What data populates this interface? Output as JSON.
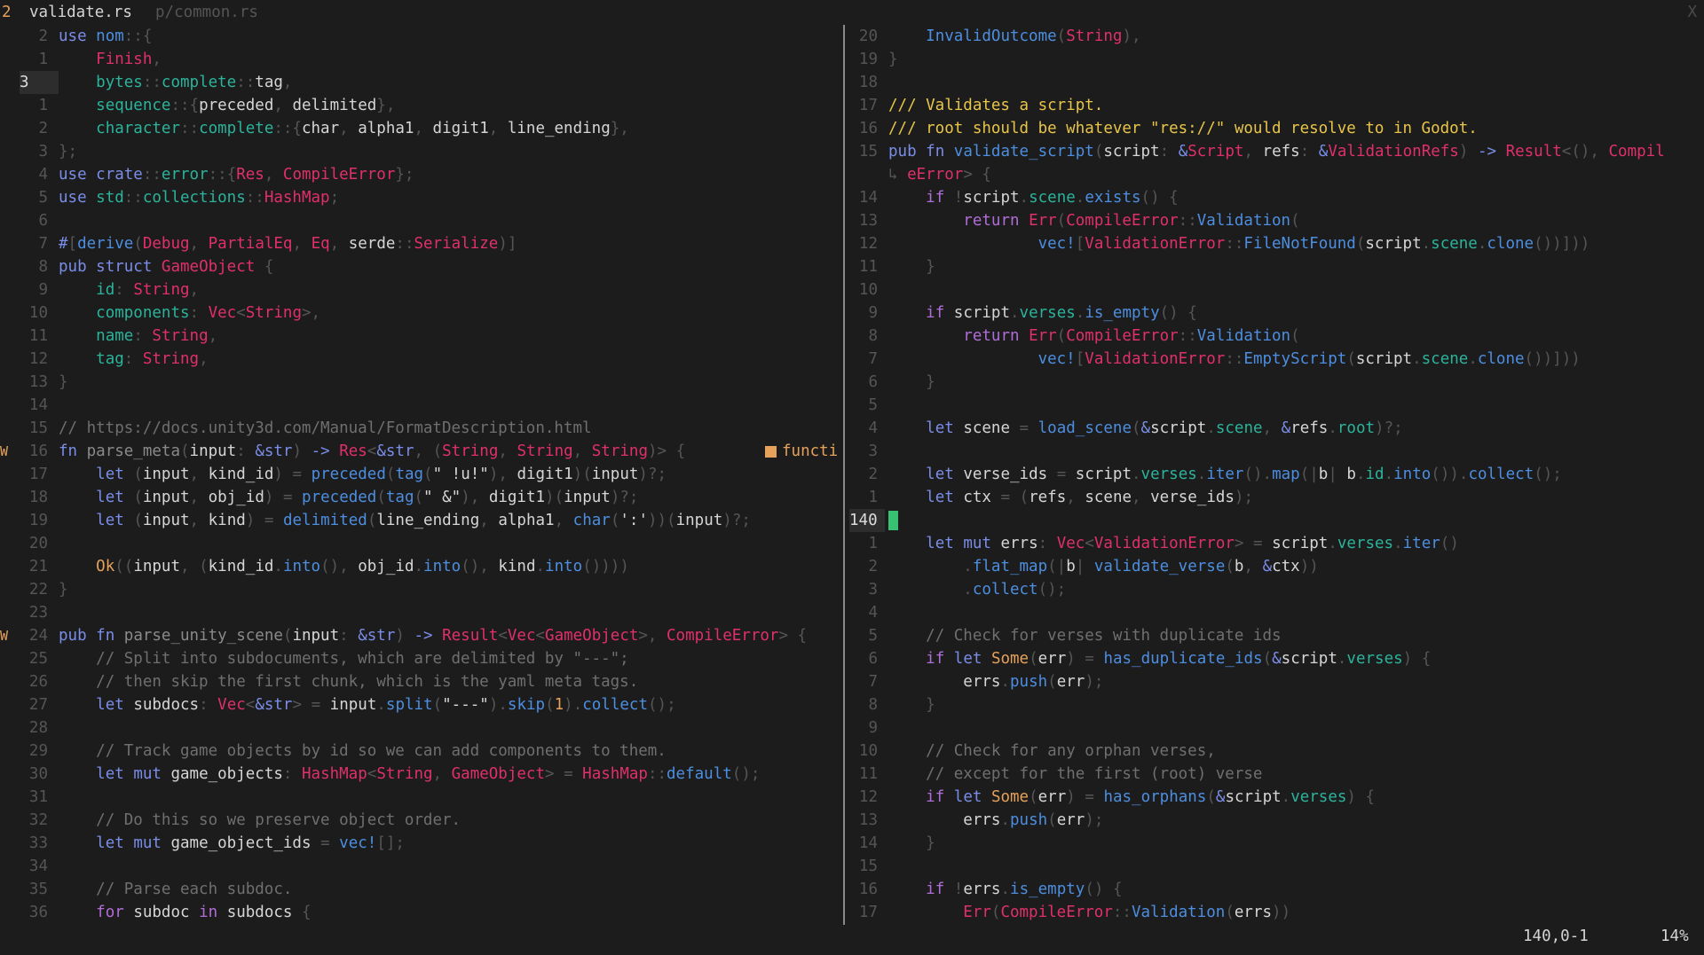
{
  "tabline": {
    "tab_number": "2",
    "active_tab": "validate.rs",
    "inactive_tab": "p/common.rs",
    "close": "X"
  },
  "left_pane": {
    "hint_label": "functi",
    "signs": [
      "W",
      "W"
    ],
    "line_numbers": [
      "2",
      "1",
      "3",
      "1",
      "2",
      "3",
      "4",
      "5",
      "6",
      "7",
      "8",
      "9",
      "10",
      "11",
      "12",
      "13",
      "14",
      "15",
      "16",
      "17",
      "18",
      "19",
      "20",
      "21",
      "22",
      "23",
      "24",
      "25",
      "26",
      "27",
      "28",
      "29",
      "30",
      "31",
      "32",
      "33",
      "34",
      "35",
      "36"
    ]
  },
  "right_pane": {
    "line_numbers": [
      "20",
      "19",
      "18",
      "17",
      "16",
      "15",
      "",
      "14",
      "13",
      "12",
      "11",
      "10",
      "9",
      "8",
      "7",
      "6",
      "5",
      "4",
      "3",
      "2",
      "1",
      "140",
      "1",
      "2",
      "3",
      "4",
      "5",
      "6",
      "7",
      "8",
      "9",
      "10",
      "11",
      "12",
      "13",
      "14",
      "15",
      "16",
      "17"
    ]
  },
  "status": {
    "position": "140,0-1",
    "percent": "14%"
  },
  "colors": {
    "background": "#1c1c1c",
    "keyword": "#7a8de8",
    "function": "#4d8ee0",
    "type": "#e0306a",
    "field": "#2bb39b",
    "doc_comment": "#e8c54a",
    "cursor": "#38c172",
    "warning_sign": "#e6a15a"
  }
}
